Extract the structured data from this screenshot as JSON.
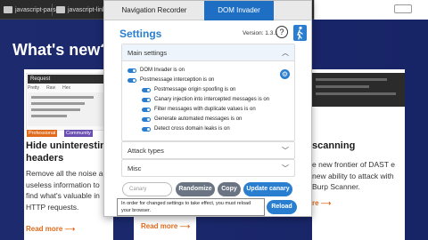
{
  "browser": {
    "bookmarks": [
      {
        "label": "javascript-parse"
      },
      {
        "label": "javascript-links"
      }
    ]
  },
  "site": {
    "heading": "What's new?",
    "card_left": {
      "request_title": "Request",
      "request_tabs": [
        "Pretty",
        "Raw",
        "Hex"
      ],
      "tags": [
        "Professional",
        "Community"
      ],
      "title_line1": "Hide uninteresting",
      "title_line2": "headers",
      "desc": "Remove all the noise and useless information to find what's valuable in HTTP requests.",
      "more": "Read more ⟶"
    },
    "card_right": {
      "title": "scanning",
      "desc": "e new frontier of DAST e new ability to attack with Burp Scanner.",
      "more": "re ⟶"
    },
    "card_mid": {
      "more": "Read more ⟶"
    }
  },
  "popup": {
    "tabs": [
      {
        "label": "Navigation Recorder",
        "active": false
      },
      {
        "label": "DOM Invader",
        "active": true
      }
    ],
    "settings_title": "Settings",
    "version": "Version: 1.3.1",
    "help_label": "?",
    "sections": {
      "main": {
        "label": "Main settings",
        "expanded": true,
        "options": [
          {
            "label": "DOM Invader is on",
            "on": true
          },
          {
            "label": "Postmessage interception is on",
            "on": true
          },
          {
            "label": "Postmessage origin spoofing is on",
            "on": true
          },
          {
            "label": "Canary injection into intercepted messages is on",
            "on": true
          },
          {
            "label": "Filter messages with duplicate values is on",
            "on": true
          },
          {
            "label": "Generate automated messages is on",
            "on": true
          },
          {
            "label": "Detect cross domain leaks is on",
            "on": true
          }
        ]
      },
      "attack": {
        "label": "Attack types",
        "expanded": false
      },
      "misc": {
        "label": "Misc",
        "expanded": false
      }
    },
    "canary_placeholder": "Canary",
    "buttons": {
      "randomize": "Randomize",
      "copy": "Copy",
      "update": "Update canary",
      "reload": "Reload"
    },
    "tooltip": "In order for changed settings to take effect, you must reload your browser.",
    "accent_color": "#2a7ed0"
  }
}
